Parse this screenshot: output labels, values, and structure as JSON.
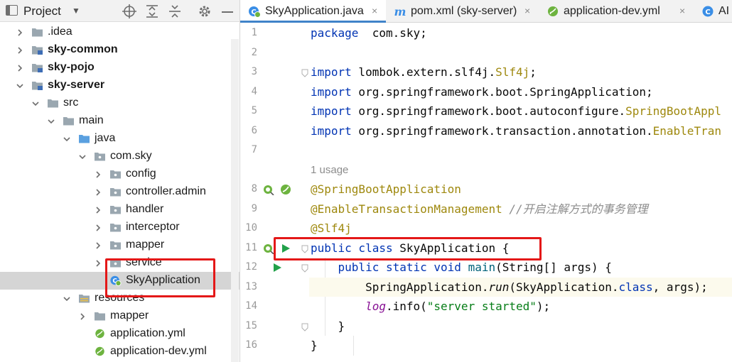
{
  "project": {
    "title": "Project",
    "dropdown_icon": "triangle-down-icon",
    "header_buttons": [
      "locate-icon",
      "expand-all-icon",
      "collapse-all-icon",
      "gear-icon",
      "minimize-icon"
    ],
    "tree": [
      {
        "label": ".idea",
        "level": 0,
        "icon": "folder-icon",
        "expanded": false,
        "bold": false
      },
      {
        "label": "sky-common",
        "level": 0,
        "icon": "module-folder-icon",
        "expanded": false,
        "bold": true
      },
      {
        "label": "sky-pojo",
        "level": 0,
        "icon": "module-folder-icon",
        "expanded": false,
        "bold": true
      },
      {
        "label": "sky-server",
        "level": 0,
        "icon": "module-folder-icon",
        "expanded": true,
        "bold": true
      },
      {
        "label": "src",
        "level": 1,
        "icon": "folder-icon",
        "expanded": true,
        "bold": false
      },
      {
        "label": "main",
        "level": 2,
        "icon": "folder-icon",
        "expanded": true,
        "bold": false
      },
      {
        "label": "java",
        "level": 3,
        "icon": "source-folder-icon",
        "expanded": true,
        "bold": false
      },
      {
        "label": "com.sky",
        "level": 4,
        "icon": "package-icon",
        "expanded": true,
        "bold": false
      },
      {
        "label": "config",
        "level": 5,
        "icon": "package-icon",
        "expanded": false,
        "bold": false
      },
      {
        "label": "controller.admin",
        "level": 5,
        "icon": "package-icon",
        "expanded": false,
        "bold": false
      },
      {
        "label": "handler",
        "level": 5,
        "icon": "package-icon",
        "expanded": false,
        "bold": false
      },
      {
        "label": "interceptor",
        "level": 5,
        "icon": "package-icon",
        "expanded": false,
        "bold": false
      },
      {
        "label": "mapper",
        "level": 5,
        "icon": "package-icon",
        "expanded": false,
        "bold": false
      },
      {
        "label": "service",
        "level": 5,
        "icon": "package-icon",
        "expanded": false,
        "bold": false
      },
      {
        "label": "SkyApplication",
        "level": 5,
        "icon": "spring-class-icon",
        "expanded": null,
        "bold": false,
        "selected": true
      },
      {
        "label": "resources",
        "level": 3,
        "icon": "resources-folder-icon",
        "expanded": true,
        "bold": false
      },
      {
        "label": "mapper",
        "level": 4,
        "icon": "folder-icon",
        "expanded": false,
        "bold": false
      },
      {
        "label": "application.yml",
        "level": 4,
        "icon": "spring-yml-icon",
        "expanded": null,
        "bold": false
      },
      {
        "label": "application-dev.yml",
        "level": 4,
        "icon": "spring-yml-icon",
        "expanded": null,
        "bold": false
      }
    ]
  },
  "tabs": [
    {
      "label": "SkyApplication.java",
      "icon": "spring-class-icon",
      "active": true,
      "close": "×"
    },
    {
      "label": "pom.xml (sky-server)",
      "icon": "maven-m-icon",
      "active": false,
      "close": "×"
    },
    {
      "label": "application-dev.yml",
      "icon": "spring-yml-icon",
      "active": false,
      "close": "×"
    },
    {
      "label": "AI",
      "icon": "class-c-icon",
      "active": false,
      "close": ""
    }
  ],
  "editor": {
    "usage_hint": "1 usage",
    "lines": [
      {
        "n": "1",
        "tokens": [
          [
            "kw",
            "package"
          ],
          [
            "",
            "  com.sky;"
          ]
        ]
      },
      {
        "n": "2",
        "tokens": []
      },
      {
        "n": "3",
        "tokens": [
          [
            "kw",
            "import"
          ],
          [
            "",
            " lombok.extern.slf4j."
          ],
          [
            "cls",
            "Slf4j"
          ],
          [
            "",
            ";"
          ]
        ]
      },
      {
        "n": "4",
        "tokens": [
          [
            "kw",
            "import"
          ],
          [
            "",
            " org.springframework.boot."
          ],
          [
            "",
            "SpringApplication"
          ],
          [
            "",
            ";"
          ]
        ]
      },
      {
        "n": "5",
        "tokens": [
          [
            "kw",
            "import"
          ],
          [
            "",
            " org.springframework.boot.autoconfigure."
          ],
          [
            "cls",
            "SpringBootAppl"
          ]
        ]
      },
      {
        "n": "6",
        "tokens": [
          [
            "kw",
            "import"
          ],
          [
            "",
            " org.springframework.transaction.annotation."
          ],
          [
            "cls",
            "EnableTran"
          ]
        ]
      },
      {
        "n": "7",
        "tokens": []
      },
      {
        "n": "8",
        "tokens": [
          [
            "ann",
            "@SpringBootApplication"
          ]
        ]
      },
      {
        "n": "9",
        "tokens": [
          [
            "ann",
            "@EnableTransactionManagement"
          ],
          [
            "",
            " "
          ],
          [
            "cmt",
            "//开启注解方式的事务管理"
          ]
        ]
      },
      {
        "n": "10",
        "tokens": [
          [
            "ann",
            "@Slf4j"
          ]
        ]
      },
      {
        "n": "11",
        "tokens": [
          [
            "kw",
            "public class"
          ],
          [
            "",
            " SkyApplication {"
          ]
        ]
      },
      {
        "n": "12",
        "tokens": [
          [
            "",
            "    "
          ],
          [
            "kw",
            "public static void"
          ],
          [
            "",
            " "
          ],
          [
            "mth",
            "main"
          ],
          [
            "",
            "(String[] args) {"
          ]
        ]
      },
      {
        "n": "13",
        "tokens": [
          [
            "",
            "        SpringApplication."
          ],
          [
            "it",
            "run"
          ],
          [
            "",
            "(SkyApplication."
          ],
          [
            "kw",
            "class"
          ],
          [
            "",
            ", args);"
          ]
        ]
      },
      {
        "n": "14",
        "tokens": [
          [
            "",
            "        "
          ],
          [
            "fld",
            "log"
          ],
          [
            "",
            ".info("
          ],
          [
            "str",
            "\"server started\""
          ],
          [
            "",
            ");"
          ]
        ]
      },
      {
        "n": "15",
        "tokens": [
          [
            "",
            "    }"
          ]
        ]
      },
      {
        "n": "16",
        "tokens": [
          [
            "",
            "}"
          ]
        ]
      }
    ]
  },
  "colors": {
    "highlight": "#e41818",
    "active_tab_underline": "#4083c9",
    "keyword": "#0033b3",
    "annotation": "#9e880d"
  }
}
